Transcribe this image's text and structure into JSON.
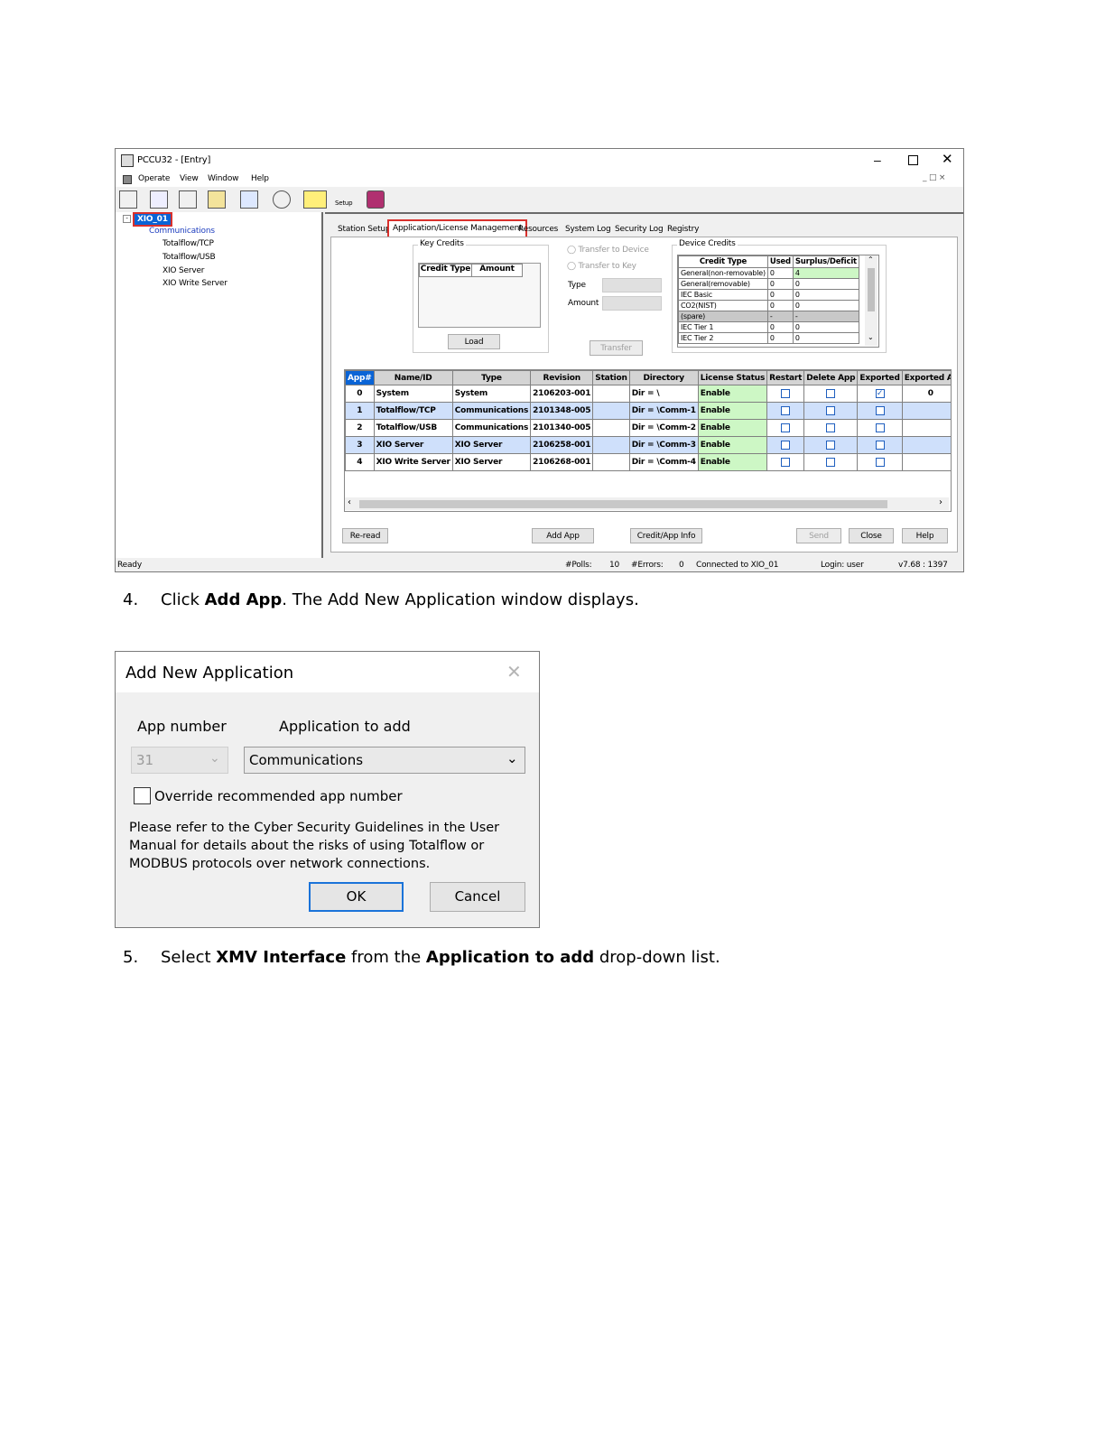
{
  "window": {
    "title": "PCCU32 - [Entry]",
    "menu": [
      "Operate",
      "View",
      "Window",
      "Help"
    ],
    "toolbar_labels": {
      "setup": "Setup"
    },
    "tree": {
      "root": "XIO_01",
      "communications": "Communications",
      "children": [
        "Totalflow/TCP",
        "Totalflow/USB",
        "XIO Server",
        "XIO Write Server"
      ]
    },
    "tabs": [
      "Station Setup",
      "Application/License Management",
      "Resources",
      "System Log",
      "Security Log",
      "Registry"
    ],
    "key_credits": {
      "label": "Key Credits",
      "col_credit_type": "Credit Type",
      "col_amount": "Amount",
      "load": "Load"
    },
    "transfer": {
      "to_device": "Transfer to Device",
      "to_key": "Transfer to Key",
      "type_label": "Type",
      "amount_label": "Amount",
      "transfer_btn": "Transfer"
    },
    "device_credits": {
      "label": "Device Credits",
      "headers": [
        "Credit Type",
        "Used",
        "Surplus/Deficit"
      ],
      "rows": [
        [
          "General(non-removable)",
          "0",
          "4"
        ],
        [
          "General(removable)",
          "0",
          "0"
        ],
        [
          "IEC Basic",
          "0",
          "0"
        ],
        [
          "CO2(NIST)",
          "0",
          "0"
        ],
        [
          "(spare)",
          "-",
          "-"
        ],
        [
          "IEC Tier 1",
          "0",
          "0"
        ],
        [
          "IEC Tier 2",
          "0",
          "0"
        ]
      ]
    },
    "apps_table": {
      "headers": [
        "App#",
        "Name/ID",
        "Type",
        "Revision",
        "Station",
        "Directory",
        "License Status",
        "Restart",
        "Delete App",
        "Exported",
        "Exported At"
      ],
      "rows": [
        {
          "num": "0",
          "name": "System",
          "type": "System",
          "rev": "2106203-001",
          "station": "",
          "dir": "Dir = \\",
          "lic": "Enable",
          "exported_checked": true,
          "exported_at": "0"
        },
        {
          "num": "1",
          "name": "Totalflow/TCP",
          "type": "Communications",
          "rev": "2101348-005",
          "station": "",
          "dir": "Dir = \\Comm-1",
          "lic": "Enable",
          "exported_checked": false,
          "exported_at": ""
        },
        {
          "num": "2",
          "name": "Totalflow/USB",
          "type": "Communications",
          "rev": "2101340-005",
          "station": "",
          "dir": "Dir = \\Comm-2",
          "lic": "Enable",
          "exported_checked": false,
          "exported_at": ""
        },
        {
          "num": "3",
          "name": "XIO Server",
          "type": "XIO Server",
          "rev": "2106258-001",
          "station": "",
          "dir": "Dir = \\Comm-3",
          "lic": "Enable",
          "exported_checked": false,
          "exported_at": ""
        },
        {
          "num": "4",
          "name": "XIO Write Server",
          "type": "XIO Server",
          "rev": "2106268-001",
          "station": "",
          "dir": "Dir = \\Comm-4",
          "lic": "Enable",
          "exported_checked": false,
          "exported_at": ""
        }
      ]
    },
    "buttons": {
      "reread": "Re-read",
      "add_app": "Add App",
      "credit_info": "Credit/App Info",
      "send": "Send",
      "close": "Close",
      "help": "Help"
    },
    "status": {
      "ready": "Ready",
      "polls_label": "#Polls:",
      "polls": "10",
      "errors_label": "#Errors:",
      "errors": "0",
      "connected": "Connected to XIO_01",
      "login": "Login: user",
      "version": "v7.68 : 1397"
    }
  },
  "step4": {
    "num": "4.",
    "pre": "Click ",
    "bold": "Add App",
    "post": ". The Add New Application window displays."
  },
  "dialog": {
    "title": "Add New Application",
    "app_number_label": "App number",
    "app_to_add_label": "Application to add",
    "app_number_value": "31",
    "app_to_add_value": "Communications",
    "override_label": "Override recommended app number",
    "note_lines": [
      "Please refer to the Cyber Security Guidelines in the User",
      "Manual for details about the risks of using Totalflow or",
      "MODBUS protocols over network connections."
    ],
    "ok": "OK",
    "cancel": "Cancel"
  },
  "step5": {
    "num": "5.",
    "pre": "Select ",
    "bold1": "XMV Interface",
    "mid": " from the ",
    "bold2": "Application to add",
    "post": " drop-down list."
  },
  "colors": {
    "selected_blue": "#0a64d6",
    "highlight_red": "#d9302c",
    "row_blue": "#cfe0fb",
    "license_green": "#cdf7c5"
  }
}
